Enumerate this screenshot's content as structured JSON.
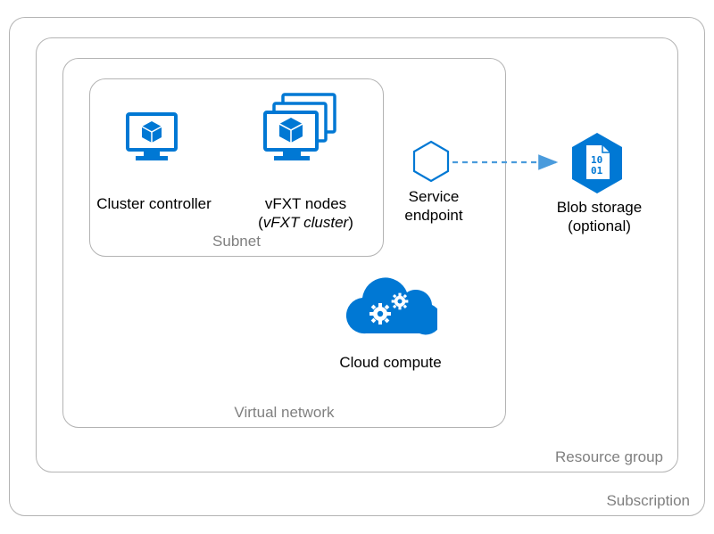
{
  "colors": {
    "azure_blue": "#0078d4",
    "border_gray": "#b3b3b3",
    "label_gray": "#808080"
  },
  "containers": {
    "subscription": "Subscription",
    "resource_group": "Resource group",
    "virtual_network": "Virtual network",
    "subnet": "Subnet"
  },
  "items": {
    "cluster_controller": "Cluster controller",
    "vfxt_nodes_line1": "vFXT nodes",
    "vfxt_nodes_line2_open": "(",
    "vfxt_nodes_line2_em": "vFXT cluster",
    "vfxt_nodes_line2_close": ")",
    "service_endpoint_line1": "Service",
    "service_endpoint_line2": "endpoint",
    "blob_storage_line1": "Blob storage",
    "blob_storage_line2": "(optional)",
    "cloud_compute": "Cloud compute"
  },
  "icons": {
    "cluster_controller": "monitor-cube-icon",
    "vfxt_nodes": "monitor-cube-stack-icon",
    "service_endpoint": "hexagon-outline-icon",
    "blob_storage": "hexagon-binary-icon",
    "cloud_compute": "cloud-gears-icon",
    "arrow": "dashed-arrow-icon"
  }
}
